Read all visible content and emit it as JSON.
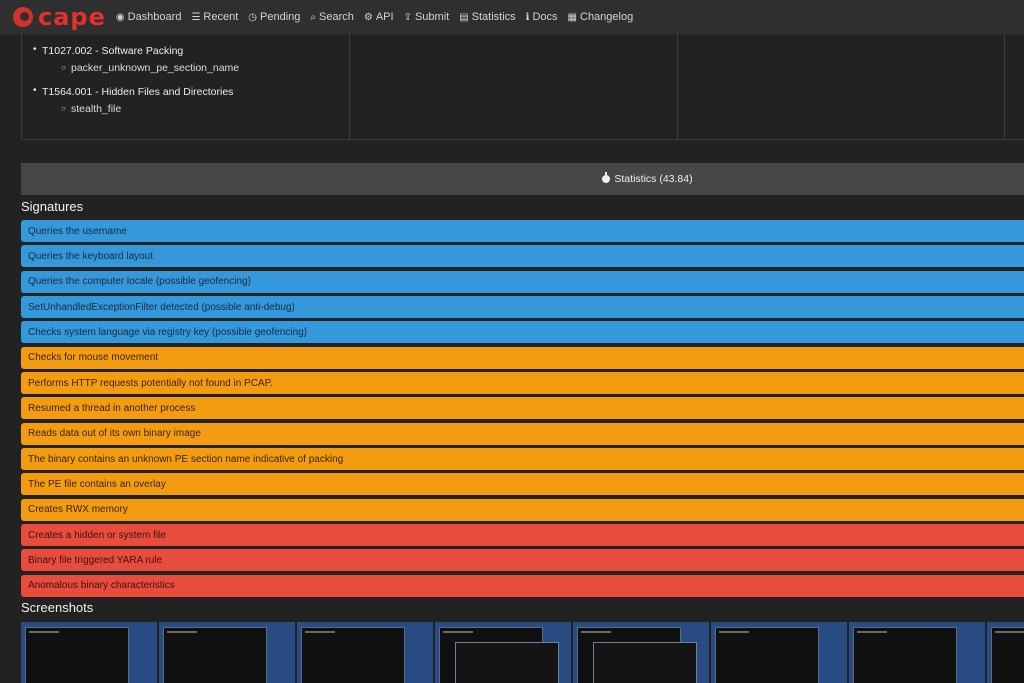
{
  "navbar": {
    "brand": "cape",
    "items": [
      {
        "icon": "dashboard-icon",
        "glyph": "◉",
        "label": "Dashboard"
      },
      {
        "icon": "list-icon",
        "glyph": "☰",
        "label": "Recent"
      },
      {
        "icon": "clock-icon",
        "glyph": "◷",
        "label": "Pending"
      },
      {
        "icon": "search-icon",
        "glyph": "⌕",
        "label": "Search"
      },
      {
        "icon": "gear-icon",
        "glyph": "⚙",
        "label": "API"
      },
      {
        "icon": "upload-icon",
        "glyph": "⇪",
        "label": "Submit"
      },
      {
        "icon": "chart-icon",
        "glyph": "▤",
        "label": "Statistics"
      },
      {
        "icon": "info-icon",
        "glyph": "ℹ",
        "label": "Docs"
      },
      {
        "icon": "newspaper-icon",
        "glyph": "▦",
        "label": "Changelog"
      }
    ]
  },
  "ttp": {
    "entries": [
      {
        "title": "T1027.002 - Software Packing",
        "sub": "packer_unknown_pe_section_name"
      },
      {
        "title": "T1564.001 - Hidden Files and Directories",
        "sub": "stealth_file"
      }
    ]
  },
  "stats": {
    "label": "Statistics (43.84)"
  },
  "signatures": {
    "title": "Signatures",
    "items": [
      {
        "label": "Queries the username",
        "severity": "info"
      },
      {
        "label": "Queries the keyboard layout",
        "severity": "info"
      },
      {
        "label": "Queries the computer locale (possible geofencing)",
        "severity": "info"
      },
      {
        "label": "SetUnhandledExceptionFilter detected (possible anti-debug)",
        "severity": "info"
      },
      {
        "label": "Checks system language via registry key (possible geofencing)",
        "severity": "info"
      },
      {
        "label": "Checks for mouse movement",
        "severity": "warn"
      },
      {
        "label": "Performs HTTP requests potentially not found in PCAP.",
        "severity": "warn"
      },
      {
        "label": "Resumed a thread in another process",
        "severity": "warn"
      },
      {
        "label": "Reads data out of its own binary image",
        "severity": "warn"
      },
      {
        "label": "The binary contains an unknown PE section name indicative of packing",
        "severity": "warn"
      },
      {
        "label": "The PE file contains an overlay",
        "severity": "warn"
      },
      {
        "label": "Creates RWX memory",
        "severity": "warn"
      },
      {
        "label": "Creates a hidden or system file",
        "severity": "danger"
      },
      {
        "label": "Binary file triggered YARA rule",
        "severity": "danger"
      },
      {
        "label": "Anomalous binary characteristics",
        "severity": "danger"
      }
    ]
  },
  "screenshots": {
    "title": "Screenshots",
    "count": 8
  },
  "colors": {
    "info": "#3498db",
    "warn": "#f39c12",
    "danger": "#e74c3c",
    "brand": "#e23131"
  }
}
